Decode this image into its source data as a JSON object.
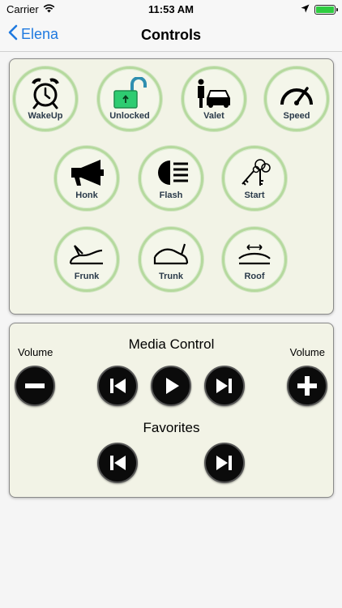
{
  "status_bar": {
    "carrier": "Carrier",
    "time": "11:53 AM",
    "battery_level": 1.0,
    "battery_color": "#2ecc40"
  },
  "nav": {
    "back_label": "Elena",
    "title": "Controls",
    "accent_color": "#1f7ae0"
  },
  "controls": [
    {
      "label": "WakeUp",
      "icon": "alarm-clock-icon"
    },
    {
      "label": "Unlocked",
      "icon": "unlocked-padlock-icon"
    },
    {
      "label": "Valet",
      "icon": "valet-car-icon"
    },
    {
      "label": "Speed",
      "icon": "speedometer-icon"
    },
    {
      "label": "Honk",
      "icon": "megaphone-icon"
    },
    {
      "label": "Flash",
      "icon": "headlight-icon"
    },
    {
      "label": "Start",
      "icon": "keys-icon"
    },
    {
      "label": "Frunk",
      "icon": "frunk-open-icon"
    },
    {
      "label": "Trunk",
      "icon": "trunk-open-icon"
    },
    {
      "label": "Roof",
      "icon": "sunroof-icon"
    }
  ],
  "media": {
    "title": "Media Control",
    "volume_left_label": "Volume",
    "volume_right_label": "Volume",
    "favorites_title": "Favorites"
  }
}
